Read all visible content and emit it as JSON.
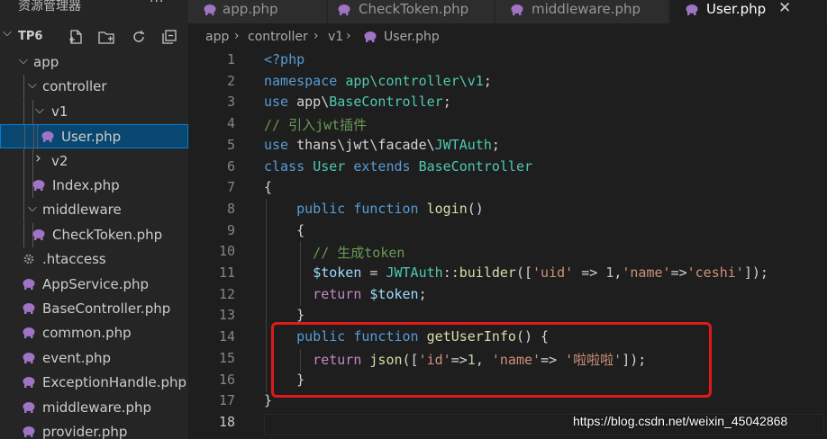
{
  "sidebar": {
    "title": "资源管理器",
    "more": "···",
    "workspace": "TP6",
    "actions": [
      {
        "name": "new-file-icon"
      },
      {
        "name": "new-folder-icon"
      },
      {
        "name": "refresh-icon"
      },
      {
        "name": "collapse-all-icon"
      }
    ],
    "tree": [
      {
        "label": "app",
        "type": "folder",
        "expanded": true
      },
      {
        "label": "controller",
        "type": "folder",
        "expanded": true
      },
      {
        "label": "v1",
        "type": "folder",
        "expanded": true
      },
      {
        "label": "User.php",
        "type": "php",
        "selected": true
      },
      {
        "label": "v2",
        "type": "folder",
        "expanded": false
      },
      {
        "label": "Index.php",
        "type": "php"
      },
      {
        "label": "middleware",
        "type": "folder",
        "expanded": true
      },
      {
        "label": "CheckToken.php",
        "type": "php"
      },
      {
        "label": ".htaccess",
        "type": "gear"
      },
      {
        "label": "AppService.php",
        "type": "php"
      },
      {
        "label": "BaseController.php",
        "type": "php"
      },
      {
        "label": "common.php",
        "type": "php"
      },
      {
        "label": "event.php",
        "type": "php"
      },
      {
        "label": "ExceptionHandle.php",
        "type": "php"
      },
      {
        "label": "middleware.php",
        "type": "php"
      },
      {
        "label": "provider.php",
        "type": "php"
      }
    ]
  },
  "tabs": [
    {
      "label": "app.php",
      "active": false
    },
    {
      "label": "CheckToken.php",
      "active": false
    },
    {
      "label": "middleware.php",
      "active": false
    },
    {
      "label": "User.php",
      "active": true,
      "close": "✕"
    }
  ],
  "breadcrumb": [
    "app",
    "controller",
    "v1",
    "User.php"
  ],
  "editor": {
    "line_numbers": [
      "1",
      "2",
      "3",
      "4",
      "5",
      "6",
      "7",
      "8",
      "9",
      "10",
      "11",
      "12",
      "13",
      "14",
      "15",
      "16",
      "17",
      "18"
    ],
    "current_line": 18,
    "lines": [
      [
        {
          "t": "<?php",
          "c": "kw"
        }
      ],
      [
        {
          "t": "namespace ",
          "c": "kw"
        },
        {
          "t": "app\\controller\\v1",
          "c": "ns"
        },
        {
          "t": ";",
          "c": "plain"
        }
      ],
      [
        {
          "t": "use ",
          "c": "kw"
        },
        {
          "t": "app\\",
          "c": "plain"
        },
        {
          "t": "BaseController",
          "c": "cls"
        },
        {
          "t": ";",
          "c": "plain"
        }
      ],
      [
        {
          "t": "// 引入jwt插件",
          "c": "cm"
        }
      ],
      [
        {
          "t": "use ",
          "c": "kw"
        },
        {
          "t": "thans\\jwt\\facade\\",
          "c": "plain"
        },
        {
          "t": "JWTAuth",
          "c": "cls"
        },
        {
          "t": ";",
          "c": "plain"
        }
      ],
      [
        {
          "t": "class ",
          "c": "kw"
        },
        {
          "t": "User ",
          "c": "cls"
        },
        {
          "t": "extends ",
          "c": "kw"
        },
        {
          "t": "BaseController",
          "c": "cls"
        }
      ],
      [
        {
          "t": "{",
          "c": "plain"
        }
      ],
      [
        {
          "t": "    public ",
          "c": "kw"
        },
        {
          "t": "function ",
          "c": "kw"
        },
        {
          "t": "login",
          "c": "fn"
        },
        {
          "t": "()",
          "c": "plain"
        }
      ],
      [
        {
          "t": "    {",
          "c": "plain"
        }
      ],
      [
        {
          "t": "      // 生成token",
          "c": "cm"
        }
      ],
      [
        {
          "t": "      ",
          "c": "plain"
        },
        {
          "t": "$token",
          "c": "var"
        },
        {
          "t": " = ",
          "c": "plain"
        },
        {
          "t": "JWTAuth",
          "c": "cls"
        },
        {
          "t": "::",
          "c": "plain"
        },
        {
          "t": "builder",
          "c": "fn"
        },
        {
          "t": "([",
          "c": "plain"
        },
        {
          "t": "'uid'",
          "c": "str"
        },
        {
          "t": " => ",
          "c": "plain"
        },
        {
          "t": "1",
          "c": "num"
        },
        {
          "t": ",",
          "c": "plain"
        },
        {
          "t": "'name'",
          "c": "str"
        },
        {
          "t": "=>",
          "c": "plain"
        },
        {
          "t": "'ceshi'",
          "c": "str"
        },
        {
          "t": "]);",
          "c": "plain"
        }
      ],
      [
        {
          "t": "      return ",
          "c": "kw2"
        },
        {
          "t": "$token",
          "c": "var"
        },
        {
          "t": ";",
          "c": "plain"
        }
      ],
      [
        {
          "t": "    }",
          "c": "plain"
        }
      ],
      [
        {
          "t": "    public ",
          "c": "kw"
        },
        {
          "t": "function ",
          "c": "kw"
        },
        {
          "t": "getUserInfo",
          "c": "fn"
        },
        {
          "t": "() {",
          "c": "plain"
        }
      ],
      [
        {
          "t": "      return ",
          "c": "kw2"
        },
        {
          "t": "json",
          "c": "fn"
        },
        {
          "t": "([",
          "c": "plain"
        },
        {
          "t": "'id'",
          "c": "str"
        },
        {
          "t": "=>",
          "c": "plain"
        },
        {
          "t": "1",
          "c": "num"
        },
        {
          "t": ", ",
          "c": "plain"
        },
        {
          "t": "'name'",
          "c": "str"
        },
        {
          "t": "=> ",
          "c": "plain"
        },
        {
          "t": "'啦啦啦'",
          "c": "str"
        },
        {
          "t": "]);",
          "c": "plain"
        }
      ],
      [
        {
          "t": "    }",
          "c": "plain"
        }
      ],
      [
        {
          "t": "}",
          "c": "plain"
        }
      ],
      []
    ]
  },
  "watermark": "https://blog.csdn.net/weixin_45042868",
  "colors": {
    "accent": "#007fd4",
    "selection": "#094771",
    "php_icon": "#a074c4",
    "annotation": "#e01a1a"
  }
}
